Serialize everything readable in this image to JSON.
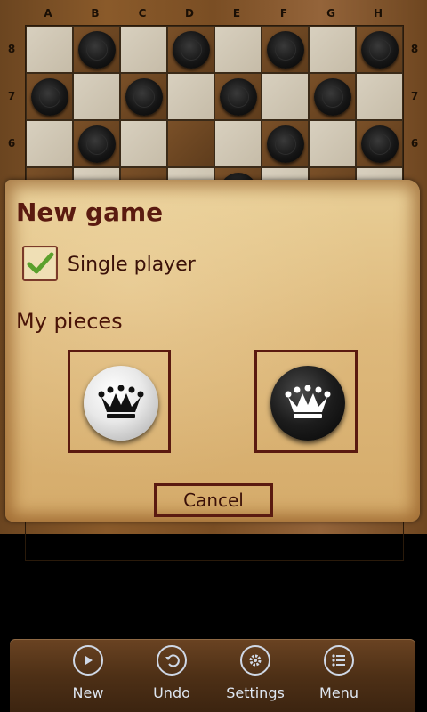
{
  "board": {
    "columns": [
      "A",
      "B",
      "C",
      "D",
      "E",
      "F",
      "G",
      "H"
    ],
    "rows": [
      "8",
      "7",
      "6"
    ]
  },
  "dialog": {
    "title": "New game",
    "single_player_label": "Single player",
    "single_player_checked": true,
    "pieces_label": "My pieces",
    "cancel_label": "Cancel"
  },
  "toolbar": {
    "new_label": "New",
    "undo_label": "Undo",
    "settings_label": "Settings",
    "menu_label": "Menu"
  },
  "colors": {
    "dialog_text": "#5a1a10",
    "toolbar_text": "#dfe7f2",
    "check_green": "#5aa02c"
  }
}
